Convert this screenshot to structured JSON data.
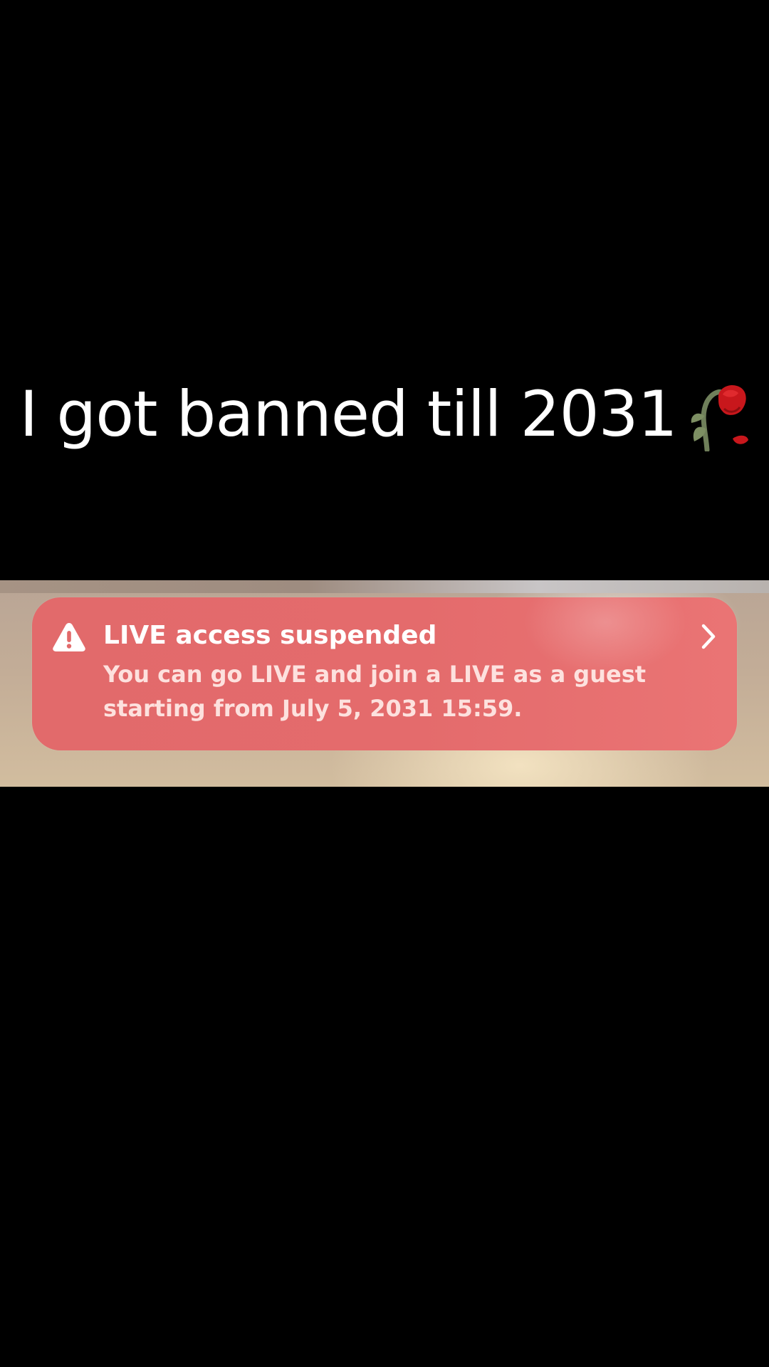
{
  "caption": {
    "text": "I got banned till 2031",
    "emoji_icon": "wilted-rose-icon"
  },
  "notification": {
    "icon": "warning-triangle-icon",
    "title": "LIVE access suspended",
    "body": "You can go LIVE and join a LIVE as a guest starting from July 5, 2031 15:59.",
    "chevron_icon": "chevron-right-icon",
    "banner_color": "#e26a6b",
    "text_color": "#ffffff"
  },
  "colors": {
    "background": "#000000",
    "caption_text": "#ffffff"
  }
}
